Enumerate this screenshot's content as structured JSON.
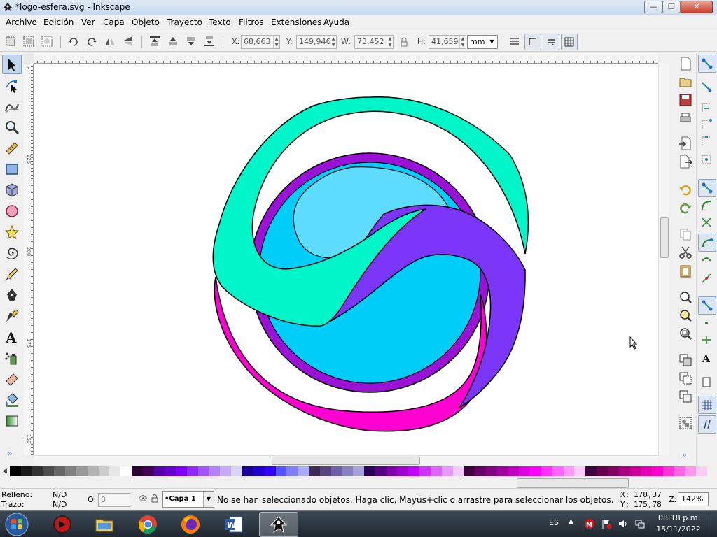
{
  "window": {
    "title": "*logo-esfera.svg - Inkscape",
    "buttons": {
      "minimize": "—",
      "maximize": "❐",
      "close": "✕"
    }
  },
  "menu": [
    "Archivo",
    "Edición",
    "Ver",
    "Capa",
    "Objeto",
    "Trayecto",
    "Texto",
    "Filtros",
    "Extensiones",
    "Ayuda"
  ],
  "controls": {
    "x_label": "X:",
    "x_value": "68,663",
    "y_label": "Y:",
    "y_value": "149,946",
    "w_label": "W:",
    "w_value": "73,452",
    "h_label": "H:",
    "h_value": "41,659",
    "unit": "mm"
  },
  "toolbox": [
    "selector-tool",
    "node-tool",
    "tweak-tool",
    "zoom-tool",
    "measure-tool",
    "rectangle-tool",
    "3d-box-tool",
    "ellipse-tool",
    "star-tool",
    "spiral-tool",
    "pencil-tool",
    "pen-tool",
    "calligraphy-tool",
    "text-tool",
    "spray-tool",
    "eraser-tool",
    "paint-bucket-tool",
    "gradient-tool"
  ],
  "rulers": {
    "vertical_labels": [
      "5",
      "225",
      "200",
      "175",
      "150"
    ]
  },
  "logo_colors": {
    "aqua": "#00f5c8",
    "sky": "#00cdfa",
    "light_sky": "#5ddcff",
    "violet": "#9a12d6",
    "purple": "#7b36fa",
    "magenta": "#ff00d0"
  },
  "palette": {
    "swatches": [
      "#000000",
      "#1a1a1a",
      "#333333",
      "#4d4d4d",
      "#666666",
      "#808080",
      "#999999",
      "#b3b3b3",
      "#cccccc",
      "#e6e6e6",
      "#ffffff",
      "#2a0033",
      "#440055",
      "#5500aa",
      "#6600cc",
      "#7f00ff",
      "#8f2aff",
      "#a055ff",
      "#b380ff",
      "#c6aaff",
      "#d9d4ff",
      "#1a0099",
      "#2200cc",
      "#3300ff",
      "#5555ff",
      "#8080ff",
      "#aaaaff",
      "#3d2a55",
      "#55447f",
      "#6e5fa6",
      "#8a80c0",
      "#a8a0d8",
      "#2a0055",
      "#550080",
      "#8000aa",
      "#a000cc",
      "#bf00ff",
      "#cc33ff",
      "#d966ff",
      "#e699ff",
      "#f2ccff",
      "#400040",
      "#660066",
      "#800080",
      "#a000a0",
      "#c000c0",
      "#e000e0",
      "#ff00ff",
      "#ff33ff",
      "#ff66ff",
      "#ff99ff",
      "#ffccff",
      "#3d003d",
      "#66004d",
      "#800060",
      "#aa0080",
      "#cc0099",
      "#e600b3",
      "#ff00cc",
      "#ff33d6",
      "#ff66e0",
      "#ff99eb",
      "#ffccf5"
    ]
  },
  "status": {
    "fill_label": "Relleno:",
    "fill_value": "N/D",
    "stroke_label": "Trazo:",
    "stroke_value": "N/D",
    "opacity_label": "O:",
    "opacity_value": "0",
    "layer": "•Capa 1",
    "message": "No se han seleccionado objetos. Haga clic, Mayús+clic o arrastre para seleccionar los objetos.",
    "cursor_x_label": "X:",
    "cursor_x": "178,37",
    "cursor_y_label": "Y:",
    "cursor_y": "175,78",
    "zoom_label": "Z:",
    "zoom": "142%"
  },
  "taskbar": {
    "apps": [
      "media-app",
      "file-explorer",
      "chrome",
      "firefox",
      "word",
      "inkscape"
    ],
    "language": "ES",
    "time": "08:18 p.m.",
    "date": "15/11/2022"
  }
}
